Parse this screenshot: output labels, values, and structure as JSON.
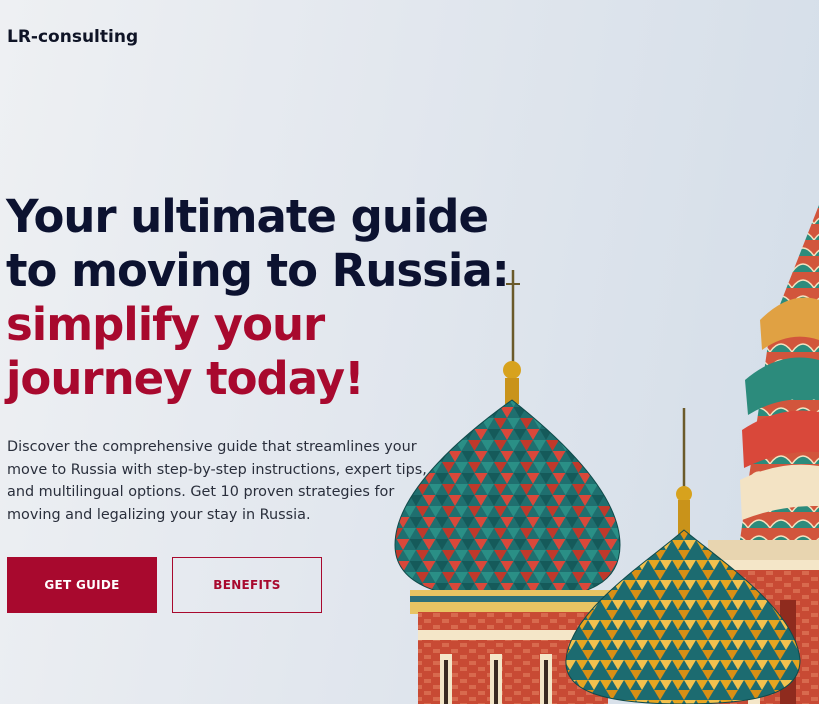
{
  "header": {
    "brand": "LR-consulting"
  },
  "hero": {
    "headline_line1": "Your ultimate guide",
    "headline_line2": "to moving to Russia:",
    "headline_accent_line1": "simplify your",
    "headline_accent_line2": "journey today!",
    "description": "Discover the comprehensive guide that streamlines your move to Russia with step-by-step instructions, expert tips, and multilingual options. Get 10 proven strategies for moving and legalizing your stay in Russia.",
    "primary_button": "GET GUIDE",
    "secondary_button": "BENEFITS"
  },
  "image": {
    "subject": "onion-dome-cathedral-illustration"
  },
  "colors": {
    "accent": "#a8092e",
    "heading": "#0c1230",
    "body_text": "#2a2f3c",
    "background": "#e2e7ee"
  }
}
